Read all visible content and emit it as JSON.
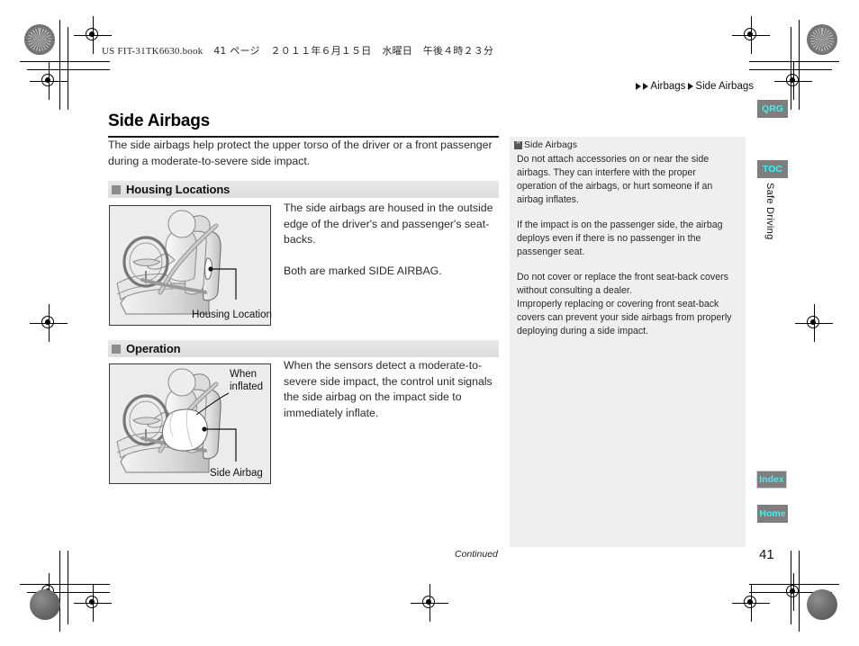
{
  "print_header": {
    "filename": "US FIT-31TK6630.book",
    "page_marker": "41 ページ",
    "date": "２０１１年６月１５日",
    "weekday": "水曜日",
    "time": "午後４時２３分"
  },
  "breadcrumb": {
    "level1": "Airbags",
    "level2": "Side Airbags"
  },
  "page": {
    "title": "Side Airbags",
    "intro": "The side airbags help protect the upper torso of the driver or a front passenger during a moderate-to-severe side impact.",
    "number": "41",
    "continued": "Continued"
  },
  "sections": [
    {
      "heading": "Housing Locations",
      "figure_caption": "Housing Location",
      "body": [
        "The side airbags are housed in the outside edge of the driver's and passenger's seat-backs.",
        "Both are marked SIDE AIRBAG."
      ]
    },
    {
      "heading": "Operation",
      "figure_caption": "Side Airbag",
      "figure_note": "When\ninflated",
      "figure_note_line1": "When",
      "figure_note_line2": "inflated",
      "body": [
        "When the sensors detect a moderate-to-severe side impact, the control unit signals the side airbag on the impact side to immediately inflate."
      ]
    }
  ],
  "notes": {
    "title": "Side Airbags",
    "paragraphs": [
      "Do not attach accessories on or near the side airbags. They can interfere with the proper operation of the airbags, or hurt someone if an airbag inflates.",
      "If the impact is on the passenger side, the airbag deploys even if there is no passenger in the passenger seat.",
      "Do not cover or replace the front seat-back covers without consulting a dealer.",
      "Improperly replacing or covering front seat-back covers can prevent your side airbags from properly deploying during a side impact."
    ]
  },
  "side_tabs": [
    {
      "label": "QRG"
    },
    {
      "label": "TOC"
    },
    {
      "label": "Index"
    },
    {
      "label": "Home"
    }
  ],
  "vertical_tab": {
    "label": "Safe Driving"
  },
  "colors": {
    "tab_background": "#7e7e7e",
    "tab_text": "#3ff0f0",
    "section_header_bg": "#e2e2e2",
    "note_panel_bg": "#efefef",
    "figure_bg": "#eeeeee"
  }
}
